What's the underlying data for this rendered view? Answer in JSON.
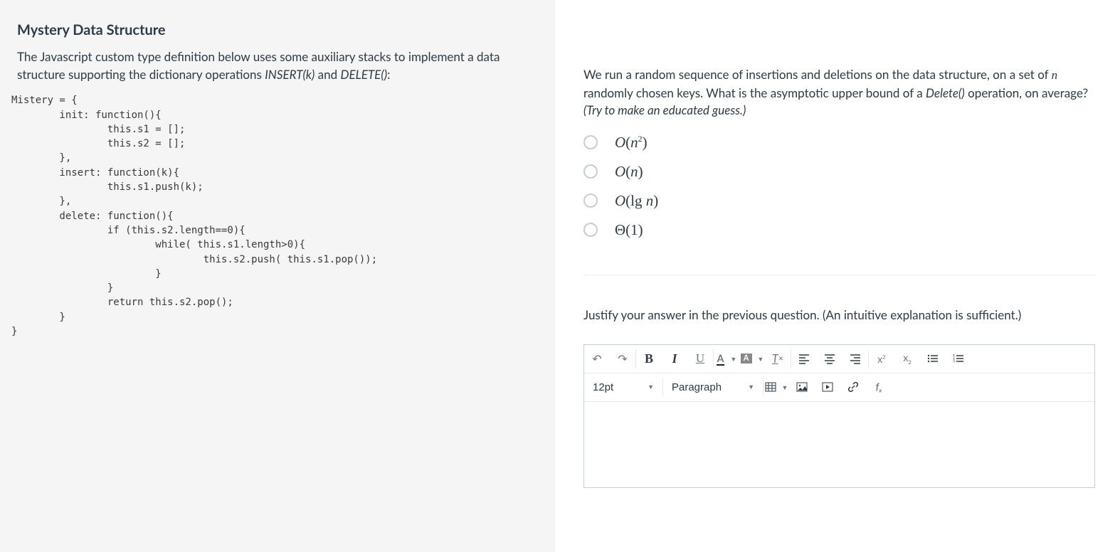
{
  "left": {
    "title": "Mystery Data Structure",
    "intro_pre": "The Javascript custom type definition below uses some auxiliary stacks to implement a data structure supporting the dictionary operations ",
    "intro_em1": "INSERT(k)",
    "intro_mid": " and ",
    "intro_em2": "DELETE()",
    "intro_post": ":",
    "code": "Mistery = {\n        init: function(){\n                this.s1 = [];\n                this.s2 = [];\n        },\n        insert: function(k){\n                this.s1.push(k);\n        },\n        delete: function(){\n                if (this.s2.length==0){\n                        while( this.s1.length>0){\n                                this.s2.push( this.s1.pop());\n                        }\n                }\n                return this.s2.pop();\n        }\n}"
  },
  "q1": {
    "prompt_a": "We run a random sequence of insertions and deletions on the data structure, on a set of ",
    "prompt_var": "n",
    "prompt_b": " randomly chosen keys.  What is the asymptotic upper bound of a ",
    "prompt_em": "Delete()",
    "prompt_c": " operation, on average? ",
    "prompt_hint": "(Try to make an educated guess.)",
    "options": [
      {
        "html": "𝑂(𝑛²)",
        "plain": "O(n^2)"
      },
      {
        "html": "𝑂(𝑛)",
        "plain": "O(n)"
      },
      {
        "html": "𝑂(lg 𝑛)",
        "plain": "O(lg n)"
      },
      {
        "html": "Θ(1)",
        "plain": "Theta(1)"
      }
    ]
  },
  "q2": {
    "prompt": "Justify your answer in the previous question. (An intuitive explanation is sufficient.)"
  },
  "editor": {
    "fontsize": "12pt",
    "format": "Paragraph"
  },
  "icons": {
    "undo": "↶",
    "redo": "↷",
    "bold": "B",
    "italic": "I",
    "underline": "U",
    "textcolor": "A",
    "bgcolor": "A",
    "clear": "𝐼ₓ",
    "alignl": "≡",
    "alignc": "≣",
    "alignr": "≡",
    "sup": "x²",
    "sub": "x₂",
    "ul": "⋮≡",
    "ol": "≣",
    "table": "⊞",
    "image": "🖼",
    "media": "▶",
    "link": "🔗",
    "fx": "𝑓ₓ"
  }
}
